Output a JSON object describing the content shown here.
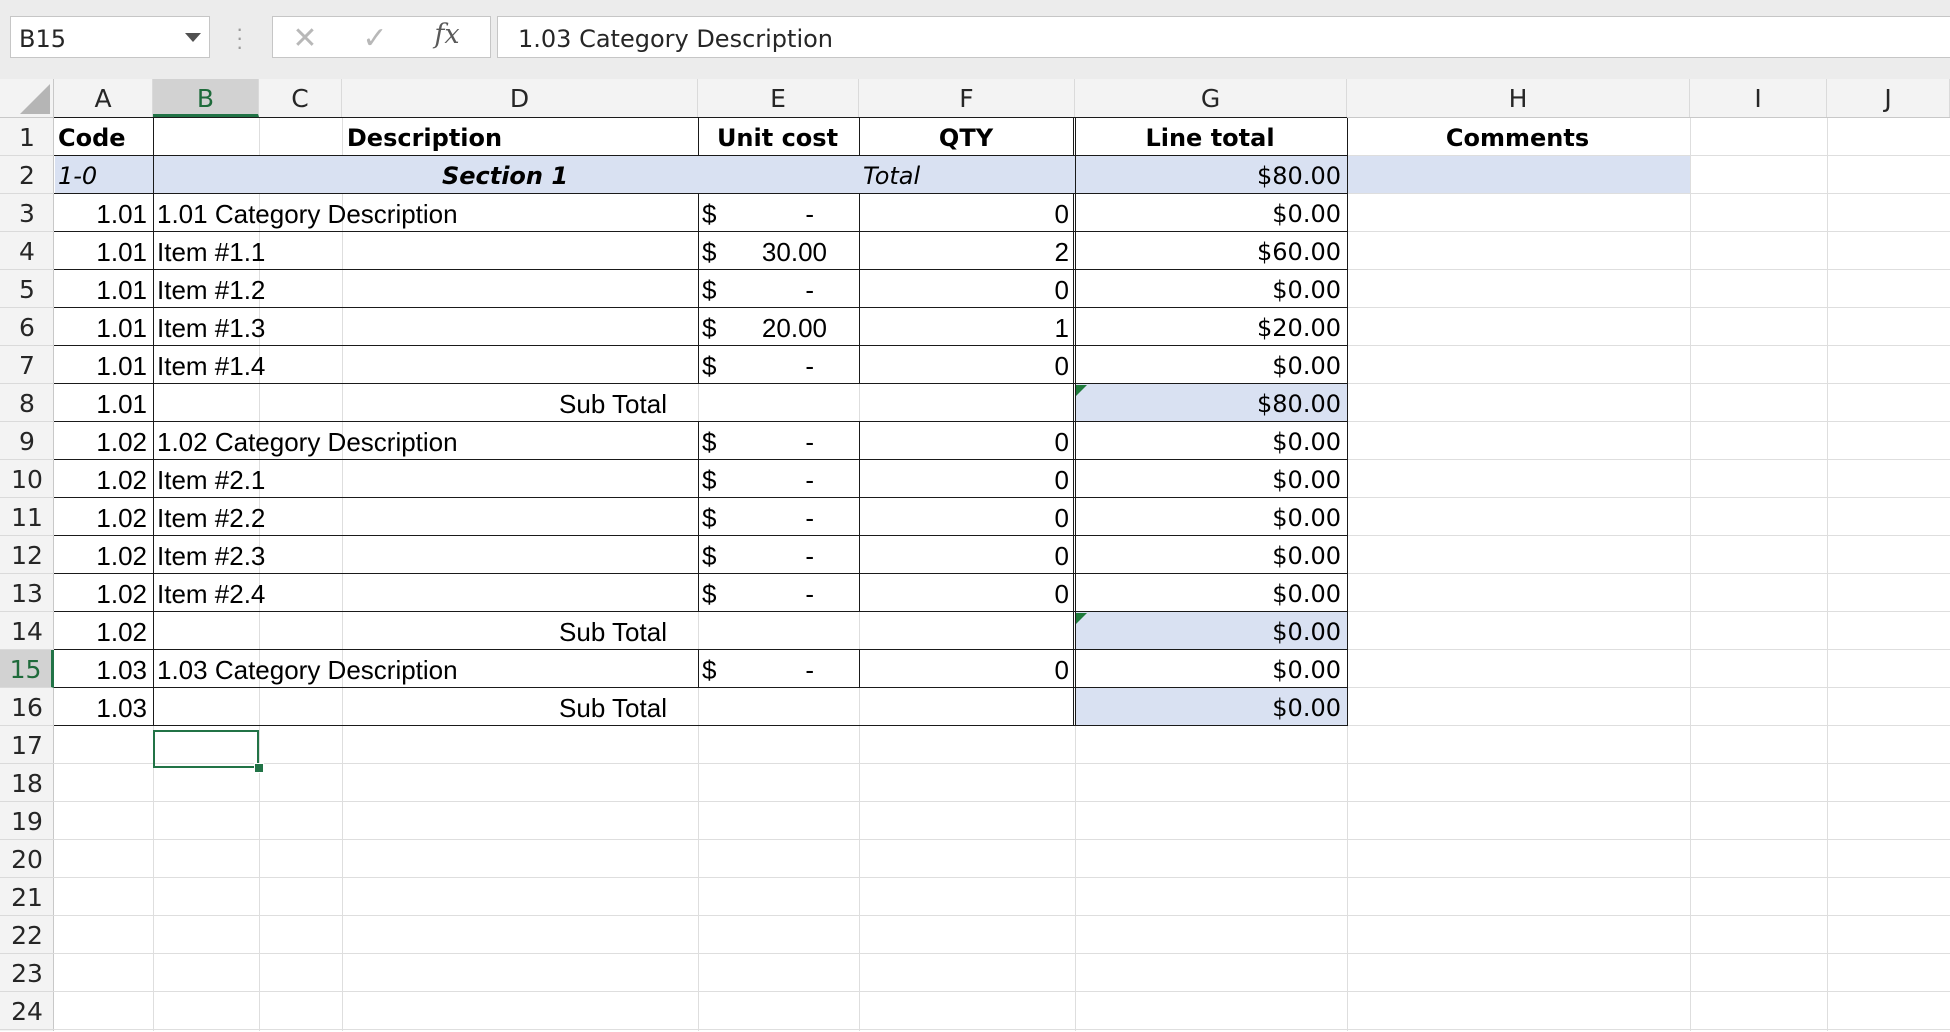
{
  "name_box": {
    "value": "B15"
  },
  "formula_bar": {
    "cancel_symbol": "✕",
    "enter_symbol": "✓",
    "fx_label": "fx",
    "value": "1.03 Category Description"
  },
  "column_headers": [
    "A",
    "B",
    "C",
    "D",
    "E",
    "F",
    "G",
    "H",
    "I",
    "J"
  ],
  "row_headers": [
    "1",
    "2",
    "3",
    "4",
    "5",
    "6",
    "7",
    "8",
    "9",
    "10",
    "11",
    "12",
    "13",
    "14",
    "15",
    "16",
    "17",
    "18",
    "19",
    "20",
    "21",
    "22",
    "23",
    "24"
  ],
  "selected_cell": "B15",
  "header_row": {
    "code": "Code",
    "description": "Description",
    "unit_cost": "Unit cost",
    "qty": "QTY",
    "line_total": "Line total",
    "comments": "Comments"
  },
  "section_row": {
    "code": "1-0",
    "name": "Section 1",
    "total_label": "Total",
    "total_value": "$80.00"
  },
  "rows": [
    {
      "code": "1.01",
      "desc": "1.01 Category Description",
      "currency": "$",
      "unit": "-",
      "qty": "0",
      "line": "$0.00"
    },
    {
      "code": "1.01",
      "desc": "Item #1.1",
      "currency": "$",
      "unit": "30.00",
      "qty": "2",
      "line": "$60.00"
    },
    {
      "code": "1.01",
      "desc": "Item #1.2",
      "currency": "$",
      "unit": "-",
      "qty": "0",
      "line": "$0.00"
    },
    {
      "code": "1.01",
      "desc": "Item #1.3",
      "currency": "$",
      "unit": "20.00",
      "qty": "1",
      "line": "$20.00"
    },
    {
      "code": "1.01",
      "desc": "Item #1.4",
      "currency": "$",
      "unit": "-",
      "qty": "0",
      "line": "$0.00"
    },
    {
      "code": "1.01",
      "subtotal_label": "Sub Total",
      "line": "$80.00"
    },
    {
      "code": "1.02",
      "desc": "1.02 Category Description",
      "currency": "$",
      "unit": "-",
      "qty": "0",
      "line": "$0.00"
    },
    {
      "code": "1.02",
      "desc": "Item #2.1",
      "currency": "$",
      "unit": "-",
      "qty": "0",
      "line": "$0.00"
    },
    {
      "code": "1.02",
      "desc": "Item #2.2",
      "currency": "$",
      "unit": "-",
      "qty": "0",
      "line": "$0.00"
    },
    {
      "code": "1.02",
      "desc": "Item #2.3",
      "currency": "$",
      "unit": "-",
      "qty": "0",
      "line": "$0.00"
    },
    {
      "code": "1.02",
      "desc": "Item #2.4",
      "currency": "$",
      "unit": "-",
      "qty": "0",
      "line": "$0.00"
    },
    {
      "code": "1.02",
      "subtotal_label": "Sub Total",
      "line": "$0.00"
    },
    {
      "code": "1.03",
      "desc": "1.03 Category Description",
      "currency": "$",
      "unit": "-",
      "qty": "0",
      "line": "$0.00"
    },
    {
      "code": "1.03",
      "subtotal_label": "Sub Total",
      "line": "$0.00"
    }
  ],
  "colors": {
    "section_fill": "#d9e1f2",
    "selection_green": "#217346"
  }
}
